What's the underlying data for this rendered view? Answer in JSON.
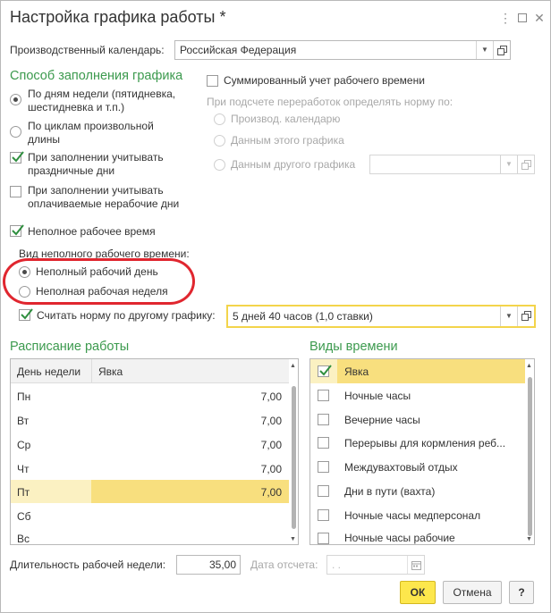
{
  "window": {
    "title": "Настройка графика работы *",
    "more_icon": "more-vertical-icon",
    "maximize_icon": "maximize-icon",
    "close_icon": "close-icon"
  },
  "calendar": {
    "label": "Производственный календарь:",
    "value": "Российская Федерация"
  },
  "fill_method": {
    "section_title": "Способ заполнения графика",
    "options": [
      {
        "label_line1": "По дням недели (пятидневка,",
        "label_line2": "шестидневка и т.п.)",
        "selected": true
      },
      {
        "label_line1": "По циклам произвольной",
        "label_line2": "длины",
        "selected": false
      }
    ],
    "holidays": {
      "label_line1": "При заполнении учитывать",
      "label_line2": "праздничные дни",
      "checked": true
    },
    "paid_nonworking": {
      "label_line1": "При заполнении учитывать",
      "label_line2": "оплачиваемые нерабочие дни",
      "checked": false
    }
  },
  "summarized": {
    "label": "Суммированный учет рабочего времени",
    "checked": false,
    "norm_caption": "При подсчете переработок определять норму по:",
    "options": [
      {
        "label": "Производ. календарю"
      },
      {
        "label": "Данным этого графика"
      },
      {
        "label": "Данным другого графика"
      }
    ]
  },
  "part_time": {
    "label": "Неполное рабочее время",
    "checked": true,
    "kind_caption": "Вид неполного рабочего времени:",
    "options": [
      {
        "label": "Неполный рабочий день",
        "selected": true
      },
      {
        "label": "Неполная рабочая неделя",
        "selected": false
      }
    ],
    "norm_other": {
      "label": "Считать норму по другому графику:",
      "checked": true,
      "value": "5 дней 40 часов (1,0 ставки)"
    }
  },
  "schedule": {
    "section_title": "Расписание работы",
    "columns": [
      "День недели",
      "Явка"
    ],
    "rows": [
      {
        "day": "Пн",
        "value": "7,00"
      },
      {
        "day": "Вт",
        "value": "7,00"
      },
      {
        "day": "Ср",
        "value": "7,00"
      },
      {
        "day": "Чт",
        "value": "7,00"
      },
      {
        "day": "Пт",
        "value": "7,00"
      },
      {
        "day": "Сб",
        "value": ""
      },
      {
        "day": "Вс",
        "value": ""
      }
    ]
  },
  "time_types": {
    "section_title": "Виды времени",
    "items": [
      {
        "label": "Явка",
        "checked": true
      },
      {
        "label": "Ночные часы",
        "checked": false
      },
      {
        "label": "Вечерние часы",
        "checked": false
      },
      {
        "label": "Перерывы для кормления реб...",
        "checked": false
      },
      {
        "label": "Междувахтовый отдых",
        "checked": false
      },
      {
        "label": "Дни в пути (вахта)",
        "checked": false
      },
      {
        "label": "Ночные часы медперсонал",
        "checked": false
      },
      {
        "label": "Ночные часы рабочие",
        "checked": false
      }
    ]
  },
  "footer": {
    "week_length_label": "Длительность рабочей недели:",
    "week_length_value": "35,00",
    "ref_date_label": "Дата отсчета:",
    "ref_date_placeholder": " .  .",
    "ok_label": "ОК",
    "cancel_label": "Отмена",
    "help_label": "?"
  },
  "colors": {
    "section_green": "#3c9a4e",
    "highlight_yellow": "#fbf1c2",
    "ok_yellow": "#fde74c",
    "annotation_red": "#e0262f"
  }
}
